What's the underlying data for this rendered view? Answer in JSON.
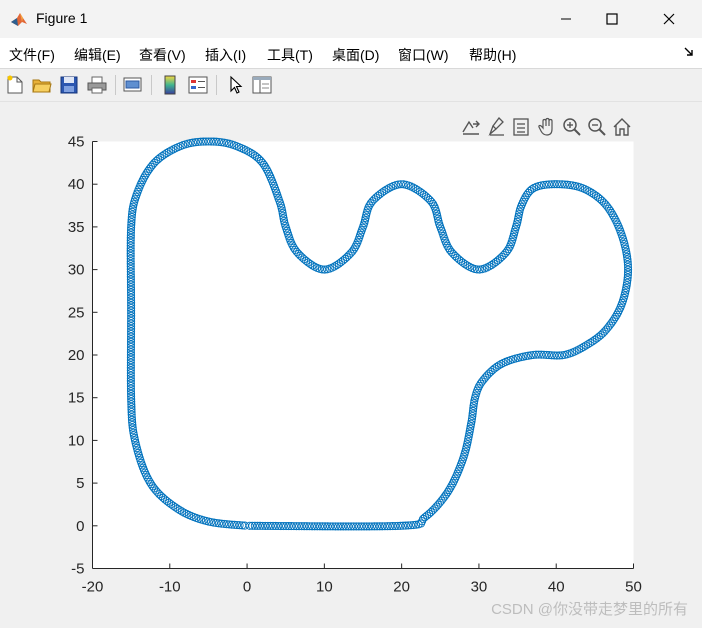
{
  "window": {
    "title": "Figure 1",
    "buttons": {
      "minimize_icon": "minimize-icon",
      "maximize_icon": "maximize-icon",
      "close_icon": "close-icon"
    }
  },
  "menu": {
    "items": [
      {
        "label": "文件(F)"
      },
      {
        "label": "编辑(E)"
      },
      {
        "label": "查看(V)"
      },
      {
        "label": "插入(I)"
      },
      {
        "label": "工具(T)"
      },
      {
        "label": "桌面(D)"
      },
      {
        "label": "窗口(W)"
      },
      {
        "label": "帮助(H)"
      }
    ]
  },
  "toolbar": {
    "icons": [
      "new-figure-icon",
      "open-file-icon",
      "save-icon",
      "print-icon",
      "link-plot-icon",
      "insert-colorbar-icon",
      "insert-legend-icon",
      "edit-plot-icon",
      "property-inspector-icon"
    ]
  },
  "axes_toolbar": {
    "icons": [
      "export-icon",
      "brush-icon",
      "data-tips-icon",
      "pan-icon",
      "zoom-in-icon",
      "zoom-out-icon",
      "home-icon"
    ]
  },
  "watermark": "CSDN @你没带走梦里的所有",
  "chart_data": {
    "type": "scatter",
    "marker": "circle-open",
    "color": "#0072bd",
    "xlim": [
      -20,
      50
    ],
    "ylim": [
      -5,
      45
    ],
    "xticks": [
      "-20",
      "-10",
      "0",
      "10",
      "20",
      "30",
      "40",
      "50"
    ],
    "yticks": [
      "-5",
      "0",
      "5",
      "10",
      "15",
      "20",
      "25",
      "30",
      "35",
      "40",
      "45"
    ],
    "grid": false,
    "path_vertices": [
      [
        0,
        0
      ],
      [
        20,
        0
      ],
      [
        23,
        1
      ],
      [
        26,
        4
      ],
      [
        28,
        8
      ],
      [
        29,
        12
      ],
      [
        29.5,
        15
      ],
      [
        30.5,
        17
      ],
      [
        33,
        19
      ],
      [
        37,
        20
      ],
      [
        41,
        20
      ],
      [
        44,
        21.2
      ],
      [
        46.5,
        23
      ],
      [
        48.5,
        26
      ],
      [
        49.3,
        30
      ],
      [
        48.5,
        34
      ],
      [
        46.5,
        37.5
      ],
      [
        43.5,
        39.5
      ],
      [
        40,
        40
      ],
      [
        37,
        39.5
      ],
      [
        35.5,
        37.5
      ],
      [
        34.8,
        35
      ],
      [
        33.5,
        32
      ],
      [
        30,
        30
      ],
      [
        26.5,
        32
      ],
      [
        25,
        35
      ],
      [
        23.8,
        38
      ],
      [
        20,
        40
      ],
      [
        16.2,
        38
      ],
      [
        15,
        35
      ],
      [
        13.5,
        32
      ],
      [
        10,
        30
      ],
      [
        6.5,
        32
      ],
      [
        5,
        35
      ],
      [
        4.2,
        38
      ],
      [
        2,
        42.5
      ],
      [
        -1.5,
        44.5
      ],
      [
        -5,
        45
      ],
      [
        -8.5,
        44.5
      ],
      [
        -12,
        42.5
      ],
      [
        -14.2,
        39
      ],
      [
        -15,
        35
      ],
      [
        -15,
        25
      ],
      [
        -15,
        15
      ],
      [
        -14.5,
        10
      ],
      [
        -12.5,
        5
      ],
      [
        -9,
        2
      ],
      [
        -5,
        0.5
      ],
      [
        0,
        0
      ]
    ]
  }
}
